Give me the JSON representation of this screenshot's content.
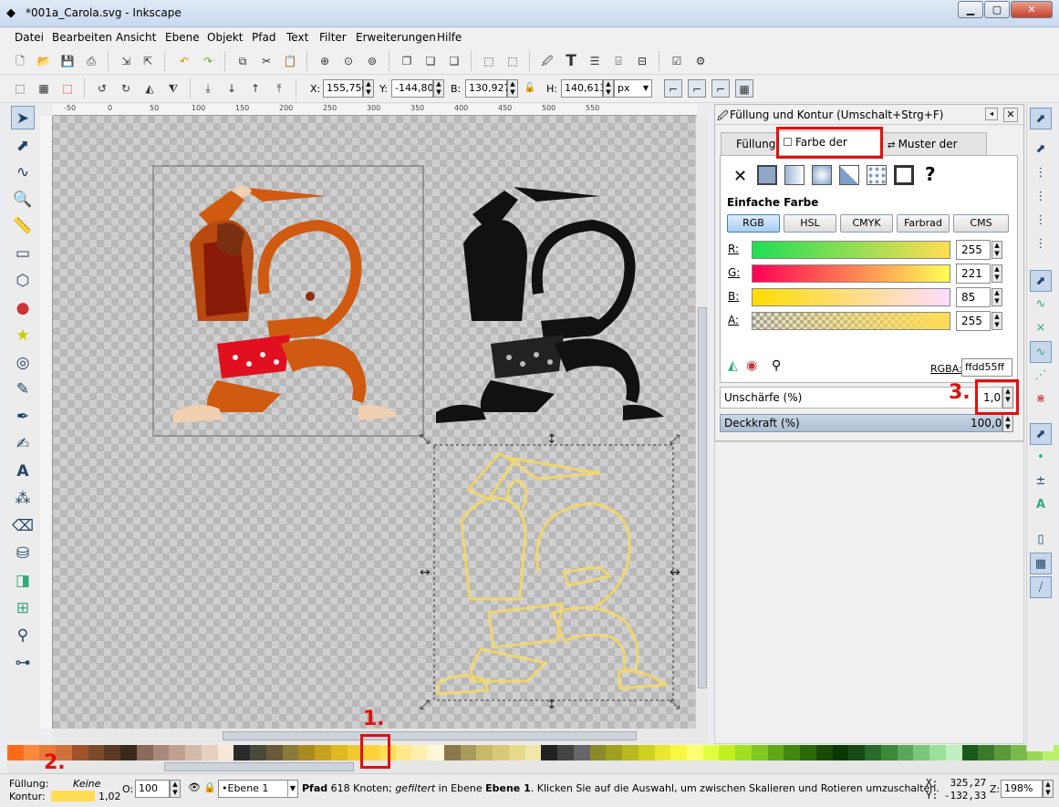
{
  "window": {
    "title": "*001a_Carola.svg - Inkscape"
  },
  "menu": [
    "Datei",
    "Bearbeiten",
    "Ansicht",
    "Ebene",
    "Objekt",
    "Pfad",
    "Text",
    "Filter",
    "Erweiterungen",
    "Hilfe"
  ],
  "toolctrl": {
    "x_label": "X:",
    "x": "155,756",
    "y_label": "Y:",
    "y": "-144,809",
    "w_label": "B:",
    "w": "130,927",
    "h_label": "H:",
    "h": "140,613",
    "unit": "px"
  },
  "ruler": [
    "-50",
    "0",
    "50",
    "100",
    "150",
    "200",
    "250",
    "300",
    "350",
    "400",
    "450",
    "500",
    "550"
  ],
  "dock": {
    "title": "Füllung und Kontur (Umschalt+Strg+F)",
    "tabs": [
      "Füllung",
      "Farbe der Kontur",
      "Muster der Kontur"
    ],
    "flat_label": "Einfache Farbe",
    "modes": [
      "RGB",
      "HSL",
      "CMYK",
      "Farbrad",
      "CMS"
    ],
    "channels": [
      {
        "label": "R:",
        "value": "255"
      },
      {
        "label": "G:",
        "value": "221"
      },
      {
        "label": "B:",
        "value": "85"
      },
      {
        "label": "A:",
        "value": "255"
      }
    ],
    "rgba_label": "RGBA:",
    "rgba": "ffdd55ff",
    "blur_label": "Unschärfe (%)",
    "blur": "1,0",
    "opacity_label": "Deckkraft (%)",
    "opacity": "100,0",
    "unset_glyph": "✕",
    "unknown_glyph": "?"
  },
  "annotations": [
    "1.",
    "2.",
    "3."
  ],
  "status": {
    "fill_label": "Füllung:",
    "fill_value": "Keine",
    "stroke_label": "Kontur:",
    "stroke_width": "1,02",
    "o_label": "O:",
    "o_value": "100",
    "layer": "•Ebene 1",
    "msg_bold": "Pfad",
    "msg_1": " 618 Knoten; ",
    "msg_italic": "gefiltert",
    "msg_2": " in Ebene ",
    "msg_layer": "Ebene 1",
    "msg_3": ". Klicken Sie auf die Auswahl, um zwischen Skalieren und Rotieren umzuschalten.",
    "cx": "X:  325,27",
    "cy": "Y: -132,33",
    "z_label": "Z:",
    "zoom": "198%"
  },
  "colors": {
    "stroke": "#ffdd55",
    "accent": "#e01010"
  }
}
